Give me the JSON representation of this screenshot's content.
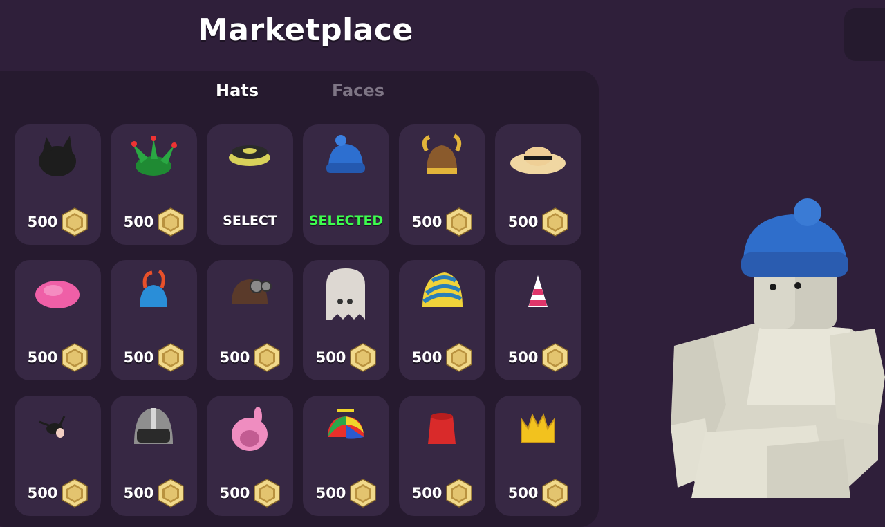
{
  "header": {
    "title": "Marketplace"
  },
  "tabs": [
    {
      "label": "Hats",
      "active": true
    },
    {
      "label": "Faces",
      "active": false
    }
  ],
  "colors": {
    "background": "#2f1f3a",
    "panel": "#261a2f",
    "card": "#372844",
    "selected_text": "#3dfc4e",
    "inactive_tab": "#7e7585",
    "coin_gold": "#d9b55a"
  },
  "items": [
    {
      "icon": "black-cat-hood-icon",
      "price": "500",
      "status": ""
    },
    {
      "icon": "green-jester-hat-icon",
      "price": "500",
      "status": ""
    },
    {
      "icon": "black-yellow-cap-icon",
      "price": "",
      "status": "SELECT"
    },
    {
      "icon": "blue-beanie-icon",
      "price": "",
      "status": "SELECTED"
    },
    {
      "icon": "gold-viking-helmet-icon",
      "price": "500",
      "status": ""
    },
    {
      "icon": "straw-hat-icon",
      "price": "500",
      "status": ""
    },
    {
      "icon": "pink-beret-icon",
      "price": "500",
      "status": ""
    },
    {
      "icon": "blue-orange-horned-hat-icon",
      "price": "500",
      "status": ""
    },
    {
      "icon": "aviator-cap-icon",
      "price": "500",
      "status": ""
    },
    {
      "icon": "ghost-hood-icon",
      "price": "500",
      "status": ""
    },
    {
      "icon": "striped-nightcap-icon",
      "price": "500",
      "status": ""
    },
    {
      "icon": "party-hat-icon",
      "price": "500",
      "status": ""
    },
    {
      "icon": "black-antenna-hat-icon",
      "price": "500",
      "status": ""
    },
    {
      "icon": "grey-helmet-icon",
      "price": "500",
      "status": ""
    },
    {
      "icon": "pink-bunny-hood-icon",
      "price": "500",
      "status": ""
    },
    {
      "icon": "propeller-cap-icon",
      "price": "500",
      "status": ""
    },
    {
      "icon": "red-fez-icon",
      "price": "500",
      "status": ""
    },
    {
      "icon": "gold-crown-icon",
      "price": "500",
      "status": ""
    }
  ],
  "avatar": {
    "icon": "player-avatar-blue-beanie"
  }
}
